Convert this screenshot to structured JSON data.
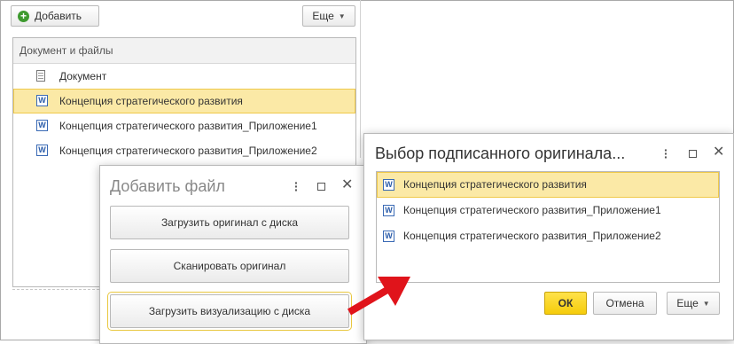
{
  "toolbar": {
    "add_label": "Добавить",
    "more_label": "Еще"
  },
  "table": {
    "header": "Документ и файлы",
    "rows": [
      {
        "label": "Документ",
        "icon": "document-icon"
      },
      {
        "label": "Концепция стратегического развития",
        "icon": "word-icon"
      },
      {
        "label": "Концепция стратегического развития_Приложение1",
        "icon": "word-icon"
      },
      {
        "label": "Концепция стратегического развития_Приложение2",
        "icon": "word-icon"
      }
    ]
  },
  "add_file_dialog": {
    "title": "Добавить файл",
    "buttons": [
      "Загрузить оригинал с диска",
      "Сканировать оригинал",
      "Загрузить визуализацию с диска"
    ]
  },
  "select_dialog": {
    "title": "Выбор подписанного оригинала...",
    "items": [
      "Концепция стратегического развития",
      "Концепция стратегического развития_Приложение1",
      "Концепция стратегического развития_Приложение2"
    ],
    "ok_label": "ОК",
    "cancel_label": "Отмена",
    "more_label": "Еще"
  },
  "colors": {
    "selection": "#fbe9a6",
    "ok_button": "#f5cc0b",
    "arrow": "#e0141b",
    "add_icon": "#3e9a2f"
  }
}
